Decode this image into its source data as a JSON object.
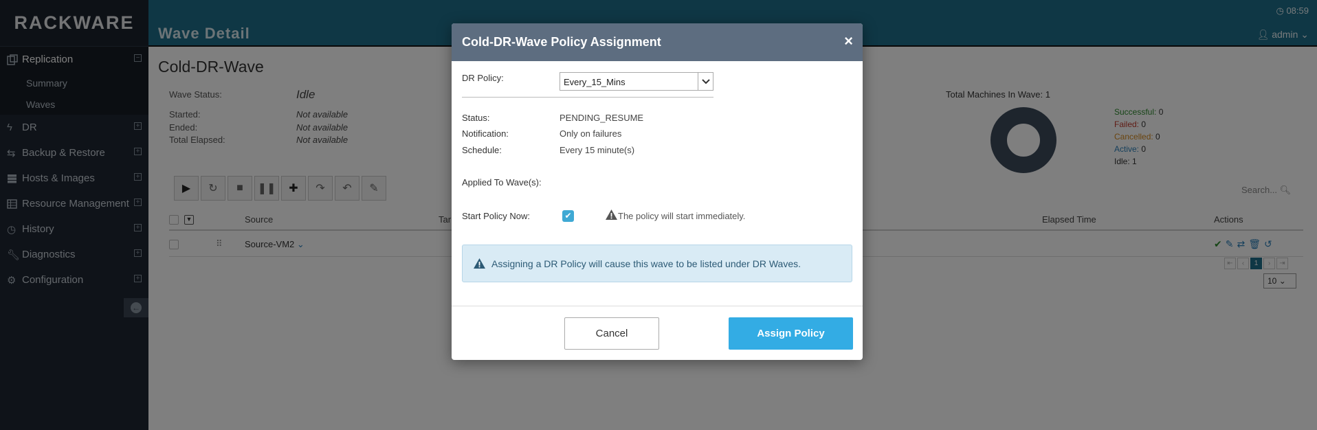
{
  "brand": "RACKWARE",
  "header": {
    "title": "Wave Detail",
    "time": "08:59",
    "user": "admin"
  },
  "sidebar": {
    "items": [
      {
        "label": "Replication",
        "active": true,
        "sub": [
          "Summary",
          "Waves"
        ]
      },
      {
        "label": "DR"
      },
      {
        "label": "Backup & Restore"
      },
      {
        "label": "Hosts & Images"
      },
      {
        "label": "Resource Management"
      },
      {
        "label": "History"
      },
      {
        "label": "Diagnostics"
      },
      {
        "label": "Configuration"
      }
    ]
  },
  "wave": {
    "name": "Cold-DR-Wave",
    "status_label": "Wave Status:",
    "status_value": "Idle",
    "started_label": "Started:",
    "started_value": "Not available",
    "ended_label": "Ended:",
    "ended_value": "Not available",
    "elapsed_label": "Total Elapsed:",
    "elapsed_value": "Not available"
  },
  "chart": {
    "title": "Total Machines In Wave: 1",
    "legend": [
      {
        "label": "Successful:",
        "value": "0",
        "color": "#2e8b2e"
      },
      {
        "label": "Failed:",
        "value": "0",
        "color": "#c0392b"
      },
      {
        "label": "Cancelled:",
        "value": "0",
        "color": "#d4881c"
      },
      {
        "label": "Active:",
        "value": "0",
        "color": "#2a7fb8"
      },
      {
        "label": "Idle:",
        "value": "1",
        "color": "#333333"
      }
    ]
  },
  "table": {
    "search_placeholder": "Search...",
    "columns": {
      "source": "Source",
      "target": "Tar",
      "elapsed": "Elapsed Time",
      "actions": "Actions"
    },
    "rows": [
      {
        "source": "Source-VM2"
      }
    ],
    "page": "1",
    "page_size": "10"
  },
  "modal": {
    "title": "Cold-DR-Wave Policy Assignment",
    "dr_policy_label": "DR Policy:",
    "dr_policy_value": "Every_15_Mins",
    "status_label": "Status:",
    "status_value": "PENDING_RESUME",
    "notification_label": "Notification:",
    "notification_value": "Only on failures",
    "schedule_label": "Schedule:",
    "schedule_value": "Every 15 minute(s)",
    "applied_label": "Applied To Wave(s):",
    "start_now_label": "Start Policy Now:",
    "start_now_note": "The policy will start immediately.",
    "alert_text": "Assigning a DR Policy will cause this wave to be listed under DR Waves.",
    "cancel_label": "Cancel",
    "assign_label": "Assign Policy"
  }
}
